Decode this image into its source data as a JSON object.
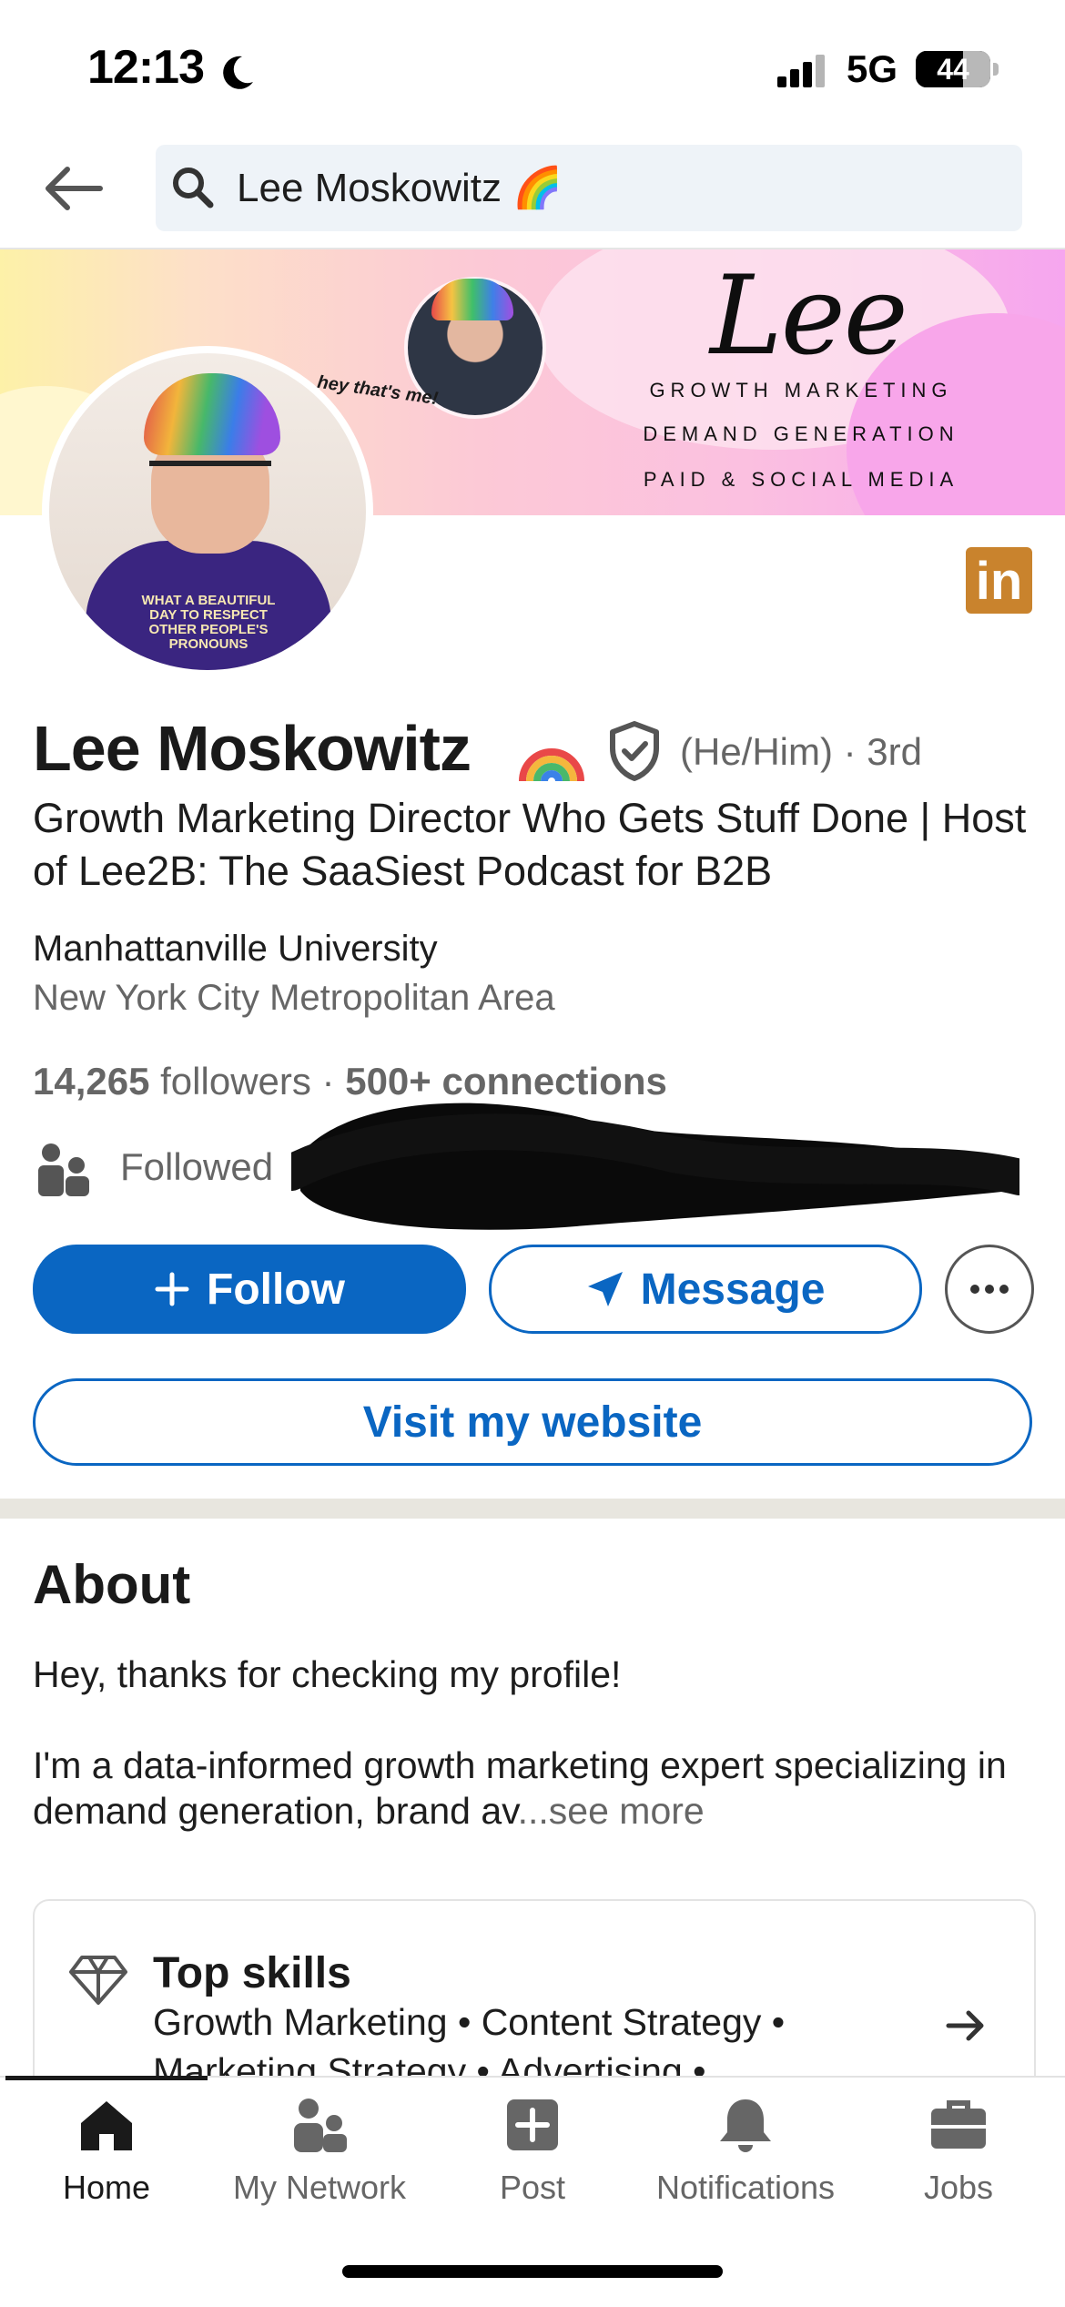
{
  "status_bar": {
    "time": "12:13",
    "network": "5G",
    "battery": "44"
  },
  "search": {
    "query": "Lee Moskowitz 🌈"
  },
  "banner": {
    "name_script": "Lee",
    "caption": "hey that's me!",
    "lines": [
      "GROWTH MARKETING",
      "DEMAND GENERATION",
      "PAID & SOCIAL MEDIA"
    ]
  },
  "avatar": {
    "shirt_text": "WHAT A BEAUTIFUL DAY TO RESPECT OTHER PEOPLE'S PRONOUNS"
  },
  "profile": {
    "name": "Lee Moskowitz",
    "name_emoji": "🌈",
    "pronouns_degree": "(He/Him) · 3rd",
    "headline": "Growth Marketing Director Who Gets Stuff Done | Host of Lee2B: The SaaSiest Podcast for B2B",
    "school": "Manhattanville University",
    "location": "New York City Metropolitan Area",
    "followers_count": "14,265",
    "followers_label": "followers",
    "separator": "·",
    "connections": "500+ connections",
    "followed_by": "Followed"
  },
  "actions": {
    "follow": "Follow",
    "message": "Message",
    "website": "Visit my website"
  },
  "about": {
    "title": "About",
    "greeting": "Hey, thanks for checking my profile!",
    "body": "I'm a data-informed growth marketing expert specializing in demand generation, brand av",
    "see_more": "...see more"
  },
  "top_skills": {
    "title": "Top skills",
    "line1": "Growth Marketing • Content Strategy •",
    "line2": "Marketing Strategy • Advertising •"
  },
  "tabs": [
    {
      "label": "Home",
      "icon": "home-icon",
      "active": true
    },
    {
      "label": "My Network",
      "icon": "network-icon",
      "active": false
    },
    {
      "label": "Post",
      "icon": "post-icon",
      "active": false
    },
    {
      "label": "Notifications",
      "icon": "bell-icon",
      "active": false
    },
    {
      "label": "Jobs",
      "icon": "briefcase-icon",
      "active": false
    }
  ],
  "colors": {
    "brand_blue": "#0a66c2",
    "badge_orange": "#c9832d",
    "muted_text": "#666666"
  }
}
